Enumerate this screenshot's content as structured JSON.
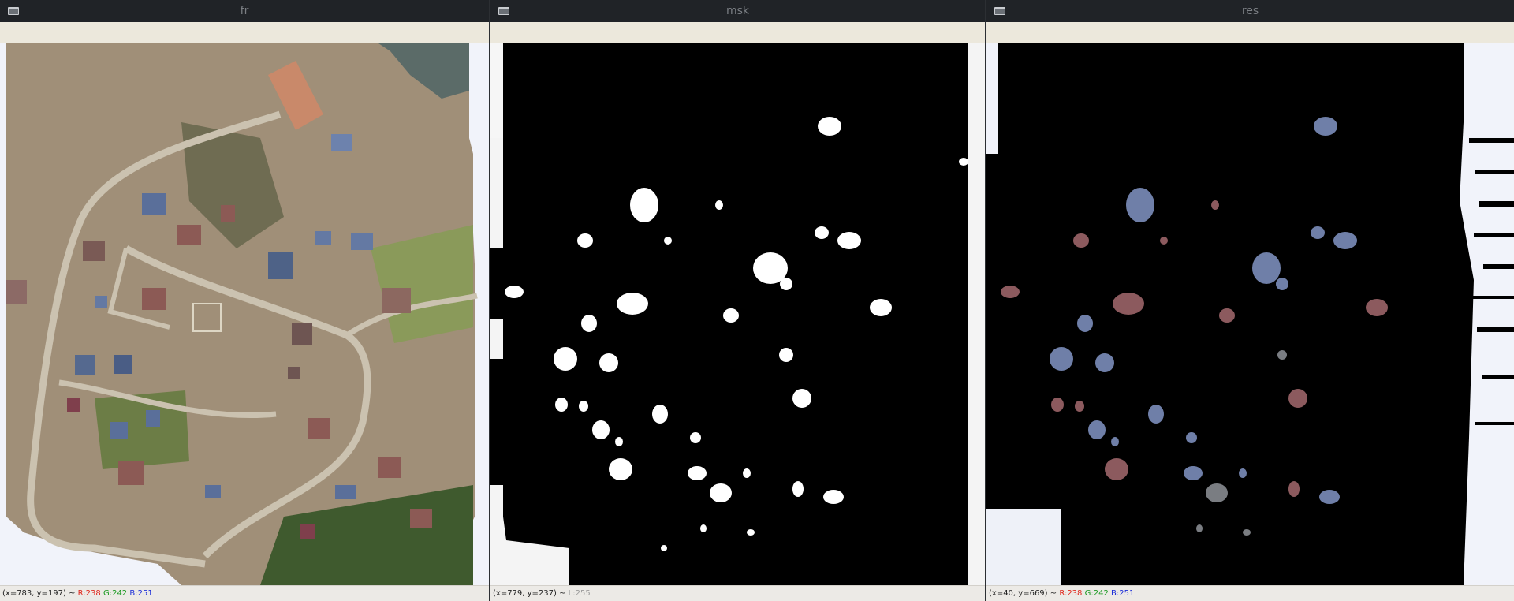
{
  "windows": [
    {
      "title": "fr",
      "status": {
        "coords": "(x=783, y=197) ~ ",
        "r": "R:238",
        "g": "G:242",
        "b": "B:251"
      }
    },
    {
      "title": "msk",
      "status": {
        "coords": "(x=779, y=237) ~ ",
        "l": "L:255"
      }
    },
    {
      "title": "res",
      "status": {
        "coords": "(x=40, y=669) ~ ",
        "r": "R:238",
        "g": "G:242",
        "b": "B:251"
      }
    }
  ],
  "colors": {
    "titlebar": "#202327",
    "status_r": "#e0261b",
    "status_g": "#1b9a22",
    "status_b": "#1d2fd8",
    "ground": "#9a8c79",
    "road": "#c9c0ae",
    "roof_blue": "#5a6f9a",
    "roof_brown": "#8c5a55"
  }
}
